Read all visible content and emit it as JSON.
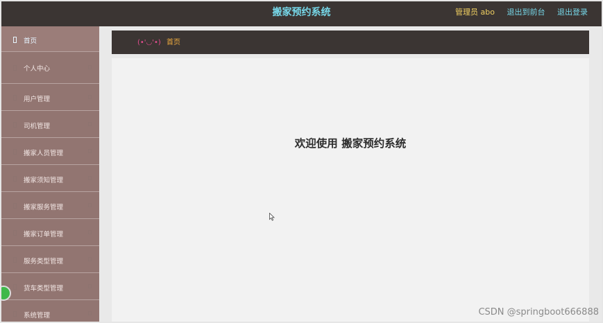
{
  "header": {
    "title": "搬家预约系统",
    "admin_label": "管理员 abo",
    "front_link": "退出到前台",
    "logout_link": "退出登录"
  },
  "sidebar": {
    "items": [
      {
        "label": "首页",
        "active": true
      },
      {
        "label": "个人中心"
      },
      {
        "label": "用户管理"
      },
      {
        "label": "司机管理"
      },
      {
        "label": "搬家人员管理"
      },
      {
        "label": "搬家须知管理"
      },
      {
        "label": "搬家服务管理"
      },
      {
        "label": "搬家订单管理"
      },
      {
        "label": "服务类型管理"
      },
      {
        "label": "货车类型管理"
      },
      {
        "label": "系统管理"
      }
    ]
  },
  "breadcrumb": {
    "kaomoji": "(•'◡'•)",
    "current": "首页"
  },
  "main": {
    "welcome": "欢迎使用 搬家预约系统"
  },
  "watermark": "CSDN @springboot666888",
  "colors": {
    "topbar": "#3b3533",
    "sidebar": "#927571",
    "title": "#76d7e8",
    "admin": "#f0cf61",
    "breadcrumb": "#eeaa3e",
    "kaomoji": "#e54d8f"
  }
}
